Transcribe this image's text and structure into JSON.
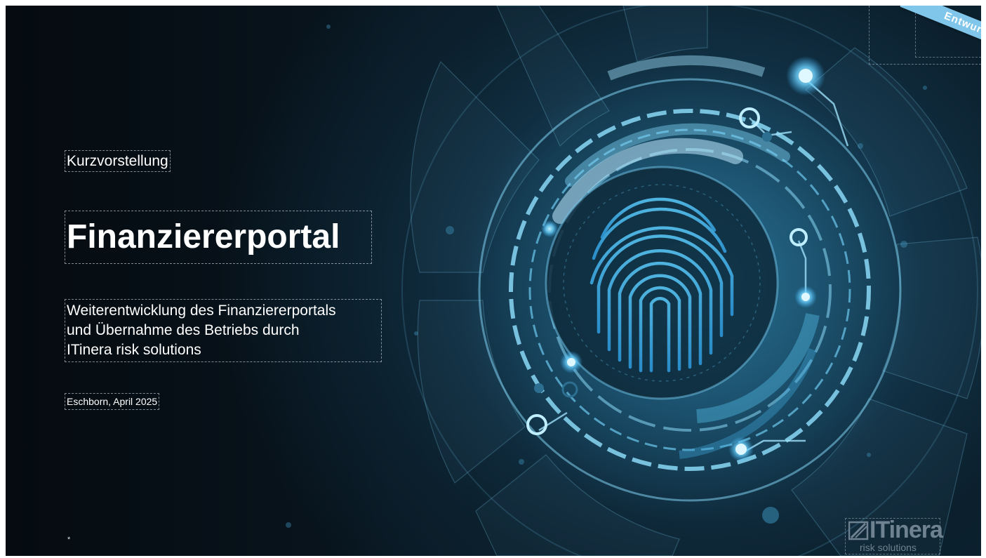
{
  "slide": {
    "kicker": "Kurzvorstellung",
    "title": "Finanziererportal",
    "subtitle_lines": [
      "Weiterentwicklung des Finanziererportals",
      "und Übernahme des Betriebs durch",
      "ITinera risk solutions"
    ],
    "date": "Eschborn, April 2025",
    "badge": "Entwurf",
    "footer_mark": "*"
  },
  "logo": {
    "name": "ITinera",
    "tagline": "risk solutions"
  },
  "colors": {
    "accent": "#7fc6ea",
    "glow": "#5fd0ff",
    "background_dark": "#050b10",
    "background_mid": "#123449"
  },
  "icons": {
    "hero": "fingerprint-icon",
    "logo": "itinera-logo-icon"
  }
}
